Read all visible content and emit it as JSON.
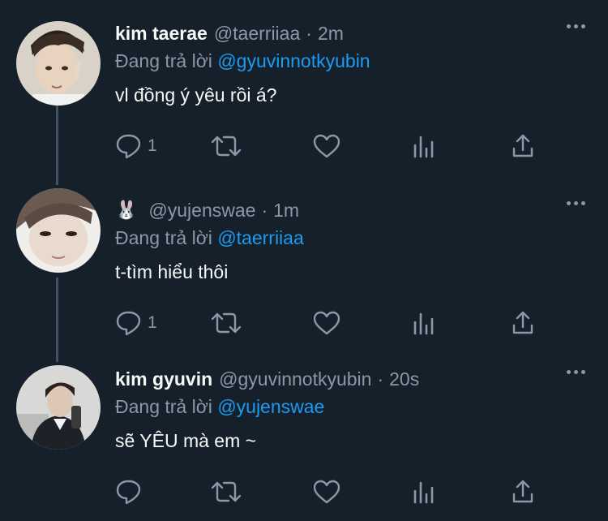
{
  "tweets": [
    {
      "name": "kim taerae",
      "handle": "@taerriiaa",
      "time": "2m",
      "replying_label": "Đang trả lời",
      "replying_to": "@gyuvinnotkyubin",
      "text": "vl đồng ý yêu rồi á?",
      "reply_count": "1"
    },
    {
      "name": "🐰",
      "handle": "@yujenswae",
      "time": "1m",
      "replying_label": "Đang trả lời",
      "replying_to": "@taerriiaa",
      "text": "t-tìm hiểu thôi",
      "reply_count": "1"
    },
    {
      "name": "kim gyuvin",
      "handle": "@gyuvinnotkyubin",
      "time": "20s",
      "replying_label": "Đang trả lời",
      "replying_to": "@yujenswae",
      "text": "sẽ YÊU mà em ~",
      "reply_count": ""
    }
  ],
  "separator": "·",
  "icons": [
    "reply-icon",
    "retweet-icon",
    "like-icon",
    "views-icon",
    "share-icon",
    "more-icon"
  ],
  "colors": {
    "background": "#15202b",
    "muted": "#8b98a5",
    "link": "#1d9bf0",
    "thread_line": "#3d5466"
  }
}
